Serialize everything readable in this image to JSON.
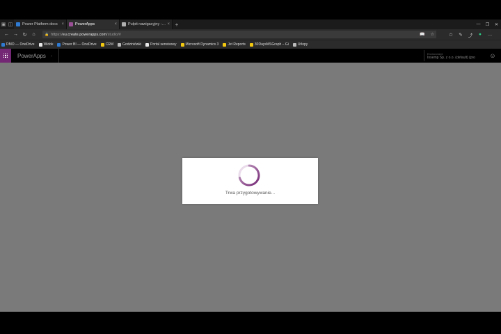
{
  "browser": {
    "tabs": [
      {
        "title": "Power Platform docs",
        "favicon_color": "#2f7bd3",
        "active": false
      },
      {
        "title": "PowerApps",
        "favicon_color": "#9b4f96",
        "active": true
      },
      {
        "title": "Pulpit nawigacyjny - Power",
        "favicon_color": "#b0b0b0",
        "active": false
      }
    ],
    "tab_close": "×",
    "new_tab": "+",
    "window_controls": {
      "minimize": "—",
      "restore": "❐",
      "close": "✕"
    },
    "nav": {
      "back": "←",
      "forward": "→",
      "refresh": "↻",
      "home": "⌂"
    },
    "url": {
      "scheme": "https://",
      "host": "eu.create.powerapps.com",
      "rest": "/studio/#"
    },
    "toolbar_icons": {
      "reading": "📖",
      "favorite": "☆",
      "favorites_list": "✩",
      "share": "⤴",
      "notes": "✎",
      "profile": "●",
      "more": "…"
    },
    "bookmarks": [
      {
        "label": "DMO — OneDrive",
        "color": "#2f7bd3"
      },
      {
        "label": "Widok",
        "color": "#e8e8e8"
      },
      {
        "label": "Power BI — OneDrive",
        "color": "#2f7bd3"
      },
      {
        "label": "CRM",
        "color": "#f2c811"
      },
      {
        "label": "Godziniówki",
        "color": "#bbbbbb"
      },
      {
        "label": "Portal serwisowy",
        "color": "#e8e8e8"
      },
      {
        "label": "Microsoft Dynamics 3",
        "color": "#f2c811"
      },
      {
        "label": "Jet Reports",
        "color": "#f2c811"
      },
      {
        "label": "30DaysMSGraph – Gi",
        "color": "#f2c811"
      },
      {
        "label": "Urlopy",
        "color": "#bbbbbb"
      }
    ]
  },
  "app": {
    "name": "PowerApps",
    "dropdown_glyph": "⌄",
    "environment_label": "Environment",
    "environment_value": "Insemp Sp. z o.o. (default) (pro",
    "header_icon": "☺",
    "accent": "#742774"
  },
  "loading": {
    "text": "Trwa przygotowywanie..."
  }
}
